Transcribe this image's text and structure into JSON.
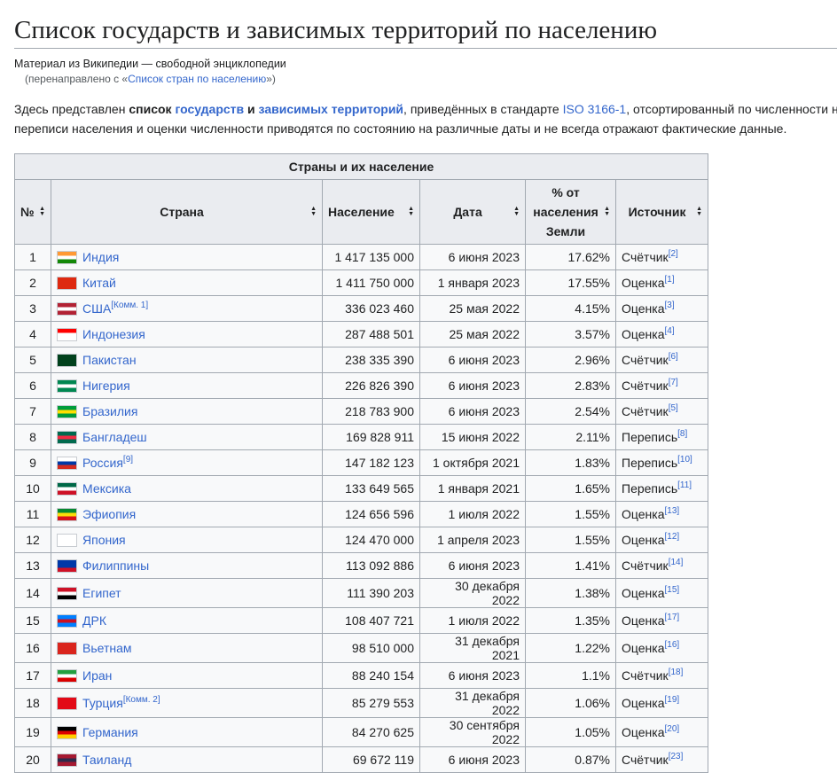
{
  "header": {
    "title": "Список государств и зависимых территорий по населению",
    "tagline": "Материал из Википедии — свободной энциклопедии",
    "redirect_prefix": "(перенаправлено с «",
    "redirect_link": "Список стран по населению",
    "redirect_suffix": "»)"
  },
  "intro": {
    "t1": "Здесь представлен ",
    "t2": "список",
    "t3": " ",
    "link_states": "государств",
    "t4": " и ",
    "link_territories": "зависимых территорий",
    "t5": ", приведённых в стандарте ",
    "link_iso": "ISO 3166-1",
    "t6": ", отсортированный по численности н",
    "line2": "переписи населения и оценки численности приводятся по состоянию на различные даты и не всегда отражают фактические данные."
  },
  "table": {
    "caption": "Страны и их население",
    "headers": {
      "num": "№",
      "country": "Страна",
      "population": "Население",
      "date": "Дата",
      "percent": "% от населения Земли",
      "source": "Источник"
    },
    "rows": [
      {
        "n": "1",
        "country": "Индия",
        "note": "",
        "population": "1 417 135 000",
        "date": "6 июня 2023",
        "percent": "17.62%",
        "source": "Счётчик",
        "ref": "[2]",
        "flag": [
          "#ff9933",
          "#ffffff",
          "#138808"
        ]
      },
      {
        "n": "2",
        "country": "Китай",
        "note": "",
        "population": "1 411 750 000",
        "date": "1 января 2023",
        "percent": "17.55%",
        "source": "Оценка",
        "ref": "[1]",
        "flag": [
          "#de2910",
          "#de2910",
          "#de2910"
        ]
      },
      {
        "n": "3",
        "country": "США",
        "note": "[Комм. 1]",
        "population": "336 023 460",
        "date": "25 мая 2022",
        "percent": "4.15%",
        "source": "Оценка",
        "ref": "[3]",
        "flag": [
          "#b22234",
          "#ffffff",
          "#b22234"
        ]
      },
      {
        "n": "4",
        "country": "Индонезия",
        "note": "",
        "population": "287 488 501",
        "date": "25 мая 2022",
        "percent": "3.57%",
        "source": "Оценка",
        "ref": "[4]",
        "flag": [
          "#ff0000",
          "#ffffff",
          "#ffffff"
        ]
      },
      {
        "n": "5",
        "country": "Пакистан",
        "note": "",
        "population": "238 335 390",
        "date": "6 июня 2023",
        "percent": "2.96%",
        "source": "Счётчик",
        "ref": "[6]",
        "flag": [
          "#01411c",
          "#01411c",
          "#01411c"
        ]
      },
      {
        "n": "6",
        "country": "Нигерия",
        "note": "",
        "population": "226 826 390",
        "date": "6 июня 2023",
        "percent": "2.83%",
        "source": "Счётчик",
        "ref": "[7]",
        "flag": [
          "#008751",
          "#ffffff",
          "#008751"
        ]
      },
      {
        "n": "7",
        "country": "Бразилия",
        "note": "",
        "population": "218 783 900",
        "date": "6 июня 2023",
        "percent": "2.54%",
        "source": "Счётчик",
        "ref": "[5]",
        "flag": [
          "#009c3b",
          "#ffdf00",
          "#009c3b"
        ]
      },
      {
        "n": "8",
        "country": "Бангладеш",
        "note": "",
        "population": "169 828 911",
        "date": "15 июня 2022",
        "percent": "2.11%",
        "source": "Перепись",
        "ref": "[8]",
        "flag": [
          "#006a4e",
          "#f42a41",
          "#006a4e"
        ]
      },
      {
        "n": "9",
        "country": "Россия",
        "note": "[9]",
        "population": "147 182 123",
        "date": "1 октября 2021",
        "percent": "1.83%",
        "source": "Перепись",
        "ref": "[10]",
        "flag": [
          "#ffffff",
          "#0039a6",
          "#d52b1e"
        ]
      },
      {
        "n": "10",
        "country": "Мексика",
        "note": "",
        "population": "133 649 565",
        "date": "1 января 2021",
        "percent": "1.65%",
        "source": "Перепись",
        "ref": "[11]",
        "flag": [
          "#006847",
          "#ffffff",
          "#ce1126"
        ]
      },
      {
        "n": "11",
        "country": "Эфиопия",
        "note": "",
        "population": "124 656 596",
        "date": "1 июля 2022",
        "percent": "1.55%",
        "source": "Оценка",
        "ref": "[13]",
        "flag": [
          "#078930",
          "#fcdd09",
          "#da121a"
        ]
      },
      {
        "n": "12",
        "country": "Япония",
        "note": "",
        "population": "124 470 000",
        "date": "1 апреля 2023",
        "percent": "1.55%",
        "source": "Оценка",
        "ref": "[12]",
        "flag": [
          "#ffffff",
          "#ffffff",
          "#ffffff"
        ]
      },
      {
        "n": "13",
        "country": "Филиппины",
        "note": "",
        "population": "113 092 886",
        "date": "6 июня 2023",
        "percent": "1.41%",
        "source": "Счётчик",
        "ref": "[14]",
        "flag": [
          "#0038a8",
          "#0038a8",
          "#ce1126"
        ]
      },
      {
        "n": "14",
        "country": "Египет",
        "note": "",
        "population": "111 390 203",
        "date": "30 декабря 2022",
        "percent": "1.38%",
        "source": "Оценка",
        "ref": "[15]",
        "flag": [
          "#ce1126",
          "#ffffff",
          "#000000"
        ]
      },
      {
        "n": "15",
        "country": "ДРК",
        "note": "",
        "population": "108 407 721",
        "date": "1 июля 2022",
        "percent": "1.35%",
        "source": "Оценка",
        "ref": "[17]",
        "flag": [
          "#007fff",
          "#ce1021",
          "#007fff"
        ]
      },
      {
        "n": "16",
        "country": "Вьетнам",
        "note": "",
        "population": "98 510 000",
        "date": "31 декабря 2021",
        "percent": "1.22%",
        "source": "Оценка",
        "ref": "[16]",
        "flag": [
          "#da251d",
          "#da251d",
          "#da251d"
        ]
      },
      {
        "n": "17",
        "country": "Иран",
        "note": "",
        "population": "88 240 154",
        "date": "6 июня 2023",
        "percent": "1.1%",
        "source": "Счётчик",
        "ref": "[18]",
        "flag": [
          "#239f40",
          "#ffffff",
          "#da0000"
        ]
      },
      {
        "n": "18",
        "country": "Турция",
        "note": "[Комм. 2]",
        "population": "85 279 553",
        "date": "31 декабря 2022",
        "percent": "1.06%",
        "source": "Оценка",
        "ref": "[19]",
        "flag": [
          "#e30a17",
          "#e30a17",
          "#e30a17"
        ]
      },
      {
        "n": "19",
        "country": "Германия",
        "note": "",
        "population": "84 270 625",
        "date": "30 сентября 2022",
        "percent": "1.05%",
        "source": "Оценка",
        "ref": "[20]",
        "flag": [
          "#000000",
          "#dd0000",
          "#ffce00"
        ]
      },
      {
        "n": "20",
        "country": "Таиланд",
        "note": "",
        "population": "69 672 119",
        "date": "6 июня 2023",
        "percent": "0.87%",
        "source": "Счётчик",
        "ref": "[23]",
        "flag": [
          "#a51931",
          "#2d2a4a",
          "#a51931"
        ]
      }
    ]
  }
}
